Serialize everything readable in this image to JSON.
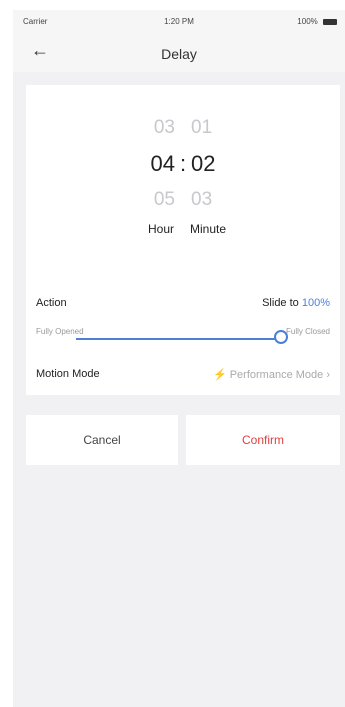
{
  "status_bar": {
    "carrier": "Carrier",
    "time": "1:20 PM",
    "battery": "100%"
  },
  "nav": {
    "title": "Delay",
    "back_icon": "arrow-left-icon"
  },
  "picker": {
    "hour_prev": "03",
    "minute_prev": "01",
    "hour": "04",
    "separator": ":",
    "minute": "02",
    "hour_next": "05",
    "minute_next": "03",
    "hour_unit": "Hour",
    "minute_unit": "Minute"
  },
  "action": {
    "label": "Action",
    "slide_prefix": "Slide to",
    "slide_value": "100%",
    "left_end": "Fully Opened",
    "right_end": "Fully Closed",
    "position_fraction": 1.0
  },
  "motion_mode": {
    "label": "Motion Mode",
    "value": "Performance Mode",
    "icon": "lightning-icon"
  },
  "buttons": {
    "cancel": "Cancel",
    "confirm": "Confirm"
  },
  "colors": {
    "accent": "#4d7fd9",
    "confirm": "#e04040",
    "background": "#f1f1f3"
  }
}
